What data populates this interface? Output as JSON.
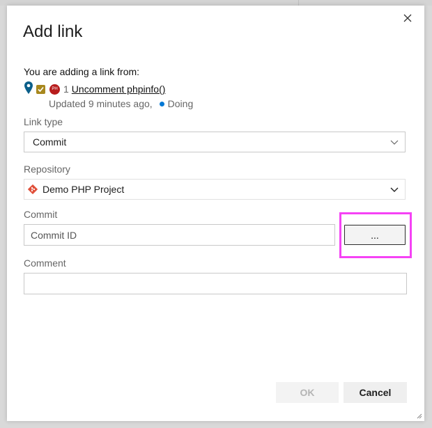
{
  "dialog": {
    "title": "Add link",
    "source_heading": "You are adding a link from:"
  },
  "work_item": {
    "avatar_initials": "PH",
    "id": "1",
    "title": "Uncomment phpinfo()",
    "updated": "Updated 9 minutes ago,",
    "state": "Doing",
    "state_color": "#0078d4",
    "checkbox_color": "#a8881e",
    "avatar_color": "#b71c1c"
  },
  "fields": {
    "link_type_label": "Link type",
    "link_type_value": "Commit",
    "repository_label": "Repository",
    "repository_value": "Demo PHP Project",
    "commit_label": "Commit",
    "commit_placeholder": "Commit ID",
    "browse_label": "...",
    "comment_label": "Comment",
    "comment_value": ""
  },
  "buttons": {
    "ok": "OK",
    "cancel": "Cancel"
  },
  "colors": {
    "highlight": "#f542f5",
    "repo_icon": "#e0503a"
  }
}
